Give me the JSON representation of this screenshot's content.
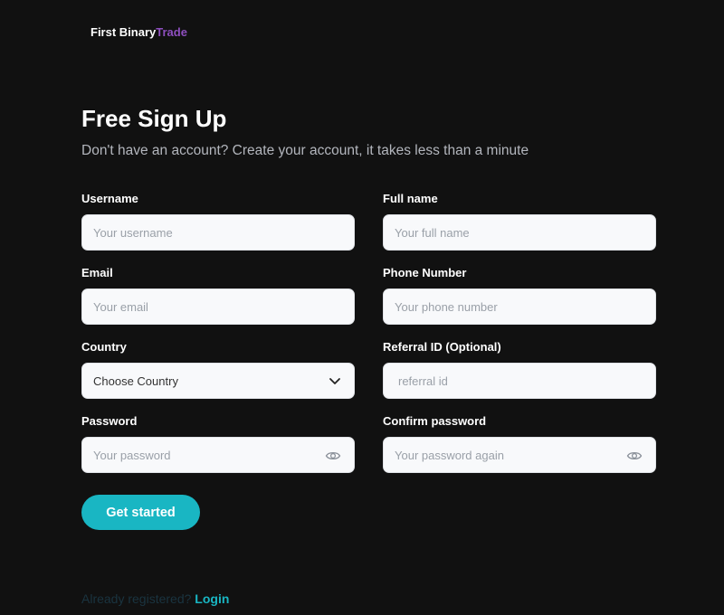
{
  "header": {
    "brand_first": "First Binary",
    "brand_accent": "Trade"
  },
  "colors": {
    "background": "#111111",
    "accent": "#19b6c3",
    "brand_accent": "#8e4fbf"
  },
  "page": {
    "title": "Free Sign Up",
    "subtitle": "Don't have an account? Create your account, it takes less than a minute"
  },
  "form": {
    "username": {
      "label": "Username",
      "placeholder": "Your username"
    },
    "fullname": {
      "label": "Full name",
      "placeholder": "Your full name"
    },
    "email": {
      "label": "Email",
      "placeholder": "Your email"
    },
    "phone": {
      "label": "Phone Number",
      "placeholder": "Your phone number"
    },
    "country": {
      "label": "Country",
      "value": "Choose Country",
      "icon": "chevron-down-icon"
    },
    "referral": {
      "label": "Referral ID (Optional)",
      "placeholder": "referral id"
    },
    "password": {
      "label": "Password",
      "placeholder": "Your password",
      "icon": "eye-icon"
    },
    "confirm_password": {
      "label": "Confirm password",
      "placeholder": "Your password again",
      "icon": "eye-icon"
    },
    "submit_label": "Get started"
  },
  "footer": {
    "prompt": "Already registered?",
    "login_label": "Login"
  }
}
